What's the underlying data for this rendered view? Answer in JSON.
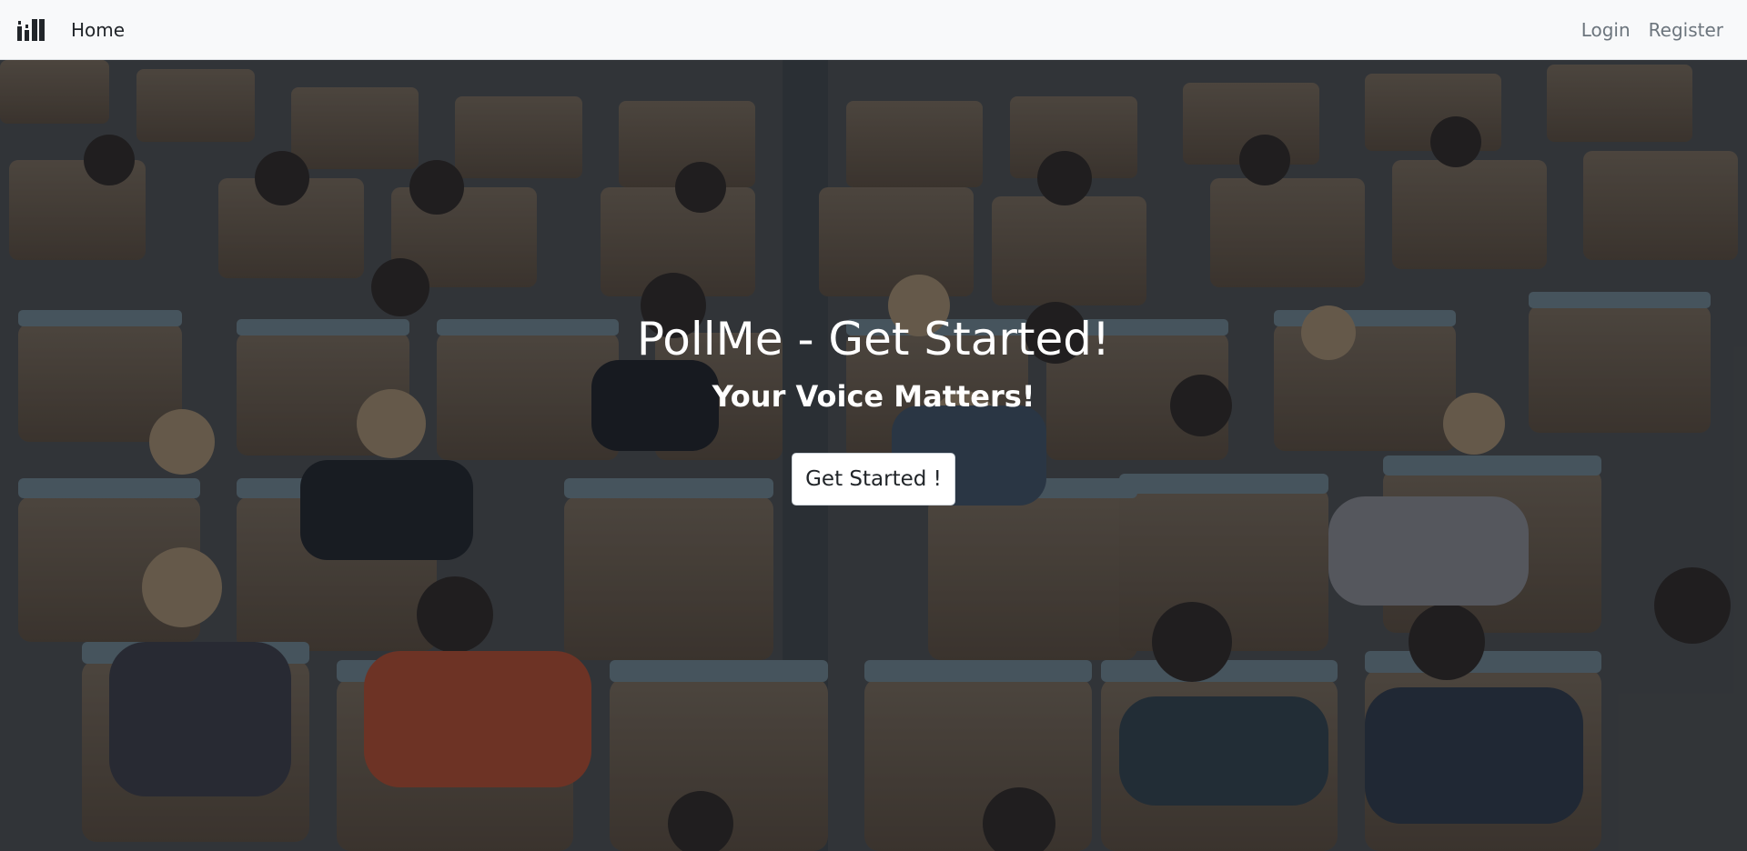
{
  "nav": {
    "home_label": "Home",
    "login_label": "Login",
    "register_label": "Register",
    "brand_icon": "poll-bars-icon"
  },
  "hero": {
    "title": "PollMe - Get Started!",
    "subtitle": "Your Voice Matters!",
    "button_label": "Get Started !",
    "background": "auditorium-audience-photo"
  },
  "colors": {
    "navbar_bg": "#f8f9fa",
    "nav_text": "#212529",
    "nav_muted": "#6c757d",
    "hero_text": "#ffffff",
    "button_bg": "#ffffff"
  }
}
